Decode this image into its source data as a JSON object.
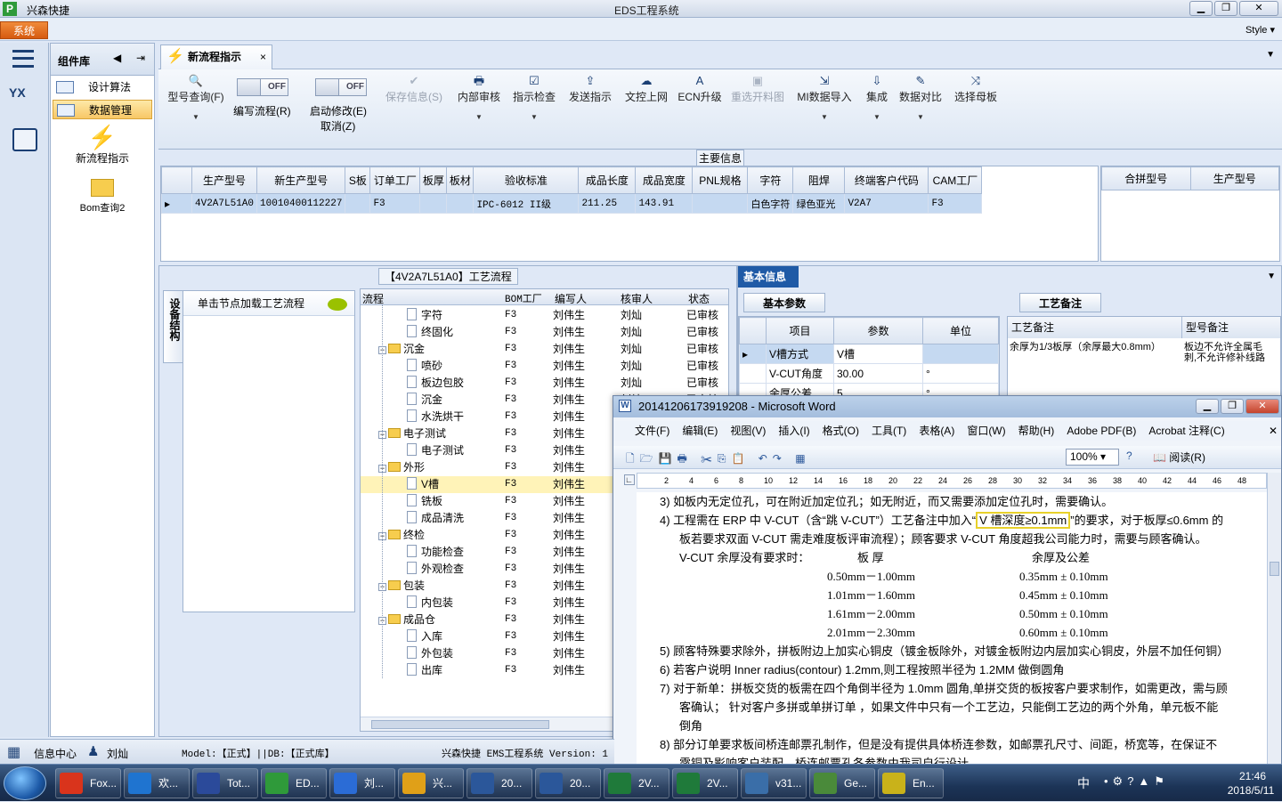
{
  "app": {
    "name": "兴森快捷",
    "title": "EDS工程系统",
    "system_menu": "系统",
    "style_label": "Style"
  },
  "left_rail": {
    "logo_text": "YX"
  },
  "component_library": {
    "title": "组件库",
    "items": [
      "设计算法",
      "数据管理"
    ],
    "shortcuts": [
      "新流程指示",
      "Bom查询2"
    ]
  },
  "tab": {
    "label": "新流程指示",
    "close": "×"
  },
  "ribbon": {
    "query": "型号查询(F)",
    "toggle1": {
      "state": "OFF",
      "label": "编写流程(R)"
    },
    "toggle2": {
      "state": "OFF",
      "label": "启动修改(E)",
      "sub": "取消(Z)"
    },
    "buttons": [
      "保存信息(S)",
      "内部审核",
      "指示检查",
      "发送指示",
      "文控上网",
      "ECN升级",
      "重选开料图",
      "MI数据导入",
      "集成",
      "数据对比",
      "选择母板"
    ]
  },
  "main_info": {
    "title": "主要信息",
    "columns": [
      "生产型号",
      "新生产型号",
      "S板",
      "订单工厂",
      "板厚",
      "板材",
      "验收标准",
      "成品长度",
      "成品宽度",
      "PNL规格",
      "字符",
      "阻焊",
      "终端客户代码",
      "CAM工厂"
    ],
    "row": [
      "4V2A7L51A0",
      "10010400112227",
      "",
      "F3",
      "",
      "",
      "IPC-6012 II级",
      "211.25",
      "143.91",
      "",
      "白色字符",
      "绿色亚光",
      "V2A7",
      "F3"
    ],
    "side_columns": [
      "合拼型号",
      "生产型号"
    ]
  },
  "process": {
    "title": "【4V2A7L51A0】工艺流程",
    "vertical_tab": "设备结构",
    "node_load": "单击节点加载工艺流程",
    "columns": [
      "流程",
      "BOM工厂",
      "编写人",
      "核审人",
      "状态"
    ],
    "rows": [
      {
        "name": "字符",
        "level": 2,
        "type": "doc",
        "factory": "F3",
        "writer": "刘伟生",
        "reviewer": "刘灿",
        "status": "已审核"
      },
      {
        "name": "终固化",
        "level": 2,
        "type": "doc",
        "factory": "F3",
        "writer": "刘伟生",
        "reviewer": "刘灿",
        "status": "已审核"
      },
      {
        "name": "沉金",
        "level": 1,
        "type": "folder",
        "factory": "F3",
        "writer": "刘伟生",
        "reviewer": "刘灿",
        "status": "已审核"
      },
      {
        "name": "喷砂",
        "level": 2,
        "type": "doc",
        "factory": "F3",
        "writer": "刘伟生",
        "reviewer": "刘灿",
        "status": "已审核"
      },
      {
        "name": "板边包胶",
        "level": 2,
        "type": "doc",
        "factory": "F3",
        "writer": "刘伟生",
        "reviewer": "刘灿",
        "status": "已审核"
      },
      {
        "name": "沉金",
        "level": 2,
        "type": "doc",
        "factory": "F3",
        "writer": "刘伟生",
        "reviewer": "刘灿",
        "status": "已审核"
      },
      {
        "name": "水洗烘干",
        "level": 2,
        "type": "doc",
        "factory": "F3",
        "writer": "刘伟生",
        "reviewer": "",
        "status": ""
      },
      {
        "name": "电子测试",
        "level": 1,
        "type": "folder",
        "factory": "F3",
        "writer": "刘伟生",
        "reviewer": "",
        "status": ""
      },
      {
        "name": "电子测试",
        "level": 2,
        "type": "doc",
        "factory": "F3",
        "writer": "刘伟生",
        "reviewer": "",
        "status": ""
      },
      {
        "name": "外形",
        "level": 1,
        "type": "folder",
        "factory": "F3",
        "writer": "刘伟生",
        "reviewer": "",
        "status": ""
      },
      {
        "name": "V槽",
        "level": 2,
        "type": "doc",
        "factory": "F3",
        "writer": "刘伟生",
        "reviewer": "",
        "status": "",
        "selected": true
      },
      {
        "name": "铣板",
        "level": 2,
        "type": "doc",
        "factory": "F3",
        "writer": "刘伟生",
        "reviewer": "",
        "status": ""
      },
      {
        "name": "成品清洗",
        "level": 2,
        "type": "doc",
        "factory": "F3",
        "writer": "刘伟生",
        "reviewer": "",
        "status": ""
      },
      {
        "name": "终检",
        "level": 1,
        "type": "folder",
        "factory": "F3",
        "writer": "刘伟生",
        "reviewer": "",
        "status": ""
      },
      {
        "name": "功能检查",
        "level": 2,
        "type": "doc",
        "factory": "F3",
        "writer": "刘伟生",
        "reviewer": "",
        "status": ""
      },
      {
        "name": "外观检查",
        "level": 2,
        "type": "doc",
        "factory": "F3",
        "writer": "刘伟生",
        "reviewer": "",
        "status": ""
      },
      {
        "name": "包装",
        "level": 1,
        "type": "folder",
        "factory": "F3",
        "writer": "刘伟生",
        "reviewer": "",
        "status": ""
      },
      {
        "name": "内包装",
        "level": 2,
        "type": "doc",
        "factory": "F3",
        "writer": "刘伟生",
        "reviewer": "",
        "status": ""
      },
      {
        "name": "成品仓",
        "level": 1,
        "type": "folder",
        "factory": "F3",
        "writer": "刘伟生",
        "reviewer": "",
        "status": ""
      },
      {
        "name": "入库",
        "level": 2,
        "type": "doc",
        "factory": "F3",
        "writer": "刘伟生",
        "reviewer": "",
        "status": ""
      },
      {
        "name": "外包装",
        "level": 2,
        "type": "doc",
        "factory": "F3",
        "writer": "刘伟生",
        "reviewer": "",
        "status": ""
      },
      {
        "name": "出库",
        "level": 2,
        "type": "doc",
        "factory": "F3",
        "writer": "刘伟生",
        "reviewer": "",
        "status": ""
      }
    ]
  },
  "basic_info": {
    "title": "基本信息",
    "tab_params": "基本参数",
    "tab_notes": "工艺备注",
    "param_columns": [
      "项目",
      "参数",
      "单位"
    ],
    "params": [
      {
        "item": "V槽方式",
        "value": "V槽",
        "unit": ""
      },
      {
        "item": "V-CUT角度",
        "value": "30.00",
        "unit": "°"
      },
      {
        "item": "余厚公差",
        "value": "5",
        "unit": "°"
      }
    ],
    "note_columns": [
      "工艺备注",
      "型号备注"
    ],
    "note_text": "余厚为1/3板厚（余厚最大0.8mm）",
    "model_note": "板边不允许全属毛刺,不允许修补线路"
  },
  "word": {
    "title": "20141206173919208 - Microsoft Word",
    "menus": [
      "文件(F)",
      "编辑(E)",
      "视图(V)",
      "插入(I)",
      "格式(O)",
      "工具(T)",
      "表格(A)",
      "窗口(W)",
      "帮助(H)",
      "Adobe PDF(B)",
      "Acrobat 注释(C)"
    ],
    "zoom": "100%",
    "read_btn": "阅读(R)",
    "ruler": [
      "2",
      "4",
      "6",
      "8",
      "10",
      "12",
      "14",
      "16",
      "18",
      "20",
      "22",
      "24",
      "26",
      "28",
      "30",
      "32",
      "34",
      "36",
      "38",
      "40",
      "42",
      "44",
      "46",
      "48"
    ],
    "lines": {
      "l3": "3)  如板内无定位孔，可在附近加定位孔；如无附近，而又需要添加定位孔时，需要确认。",
      "l4a": "4)  工程需在 ERP 中 V-CUT（含“跳 V-CUT”）工艺备注中加入“",
      "l4hl": "V 槽深度≥0.1mm",
      "l4b": "”的要求，对于板厚≤0.6mm 的",
      "l4c": "板若要求双面 V-CUT 需走难度板评审流程）；顾客要求 V-CUT 角度超我公司能力时，需要与顾客确认。",
      "l4d": "V-CUT 余厚没有要求时：",
      "col_thk": "板  厚",
      "col_res": "余厚及公差",
      "t1a": "0.50mm－1.00mm",
      "t1b": "0.35mm ± 0.10mm",
      "t2a": "1.01mm－1.60mm",
      "t2b": "0.45mm ± 0.10mm",
      "t3a": "1.61mm－2.00mm",
      "t3b": "0.50mm ± 0.10mm",
      "t4a": "2.01mm－2.30mm",
      "t4b": "0.60mm ± 0.10mm",
      "l5": "5)  顾客特殊要求除外，拼板附边上加实心铜皮（镀金板除外，对镀金板附边内层加实心铜皮，外层不加任何铜）",
      "l6": "6)  若客户说明 Inner radius(contour) 1.2mm,则工程按照半径为 1.2MM 做倒圆角",
      "l7a": "7)  对于新单：拼板交货的板需在四个角倒半径为 1.0mm 圆角,单拼交货的板按客户要求制作，如需更改，需与顾",
      "l7b": "客确认；  针对客户多拼或单拼订单 ，如果文件中只有一个工艺边，只能倒工艺边的两个外角，单元板不能",
      "l7c": "倒角",
      "l8a": "8)  部分订单要求板间桥连邮票孔制作，但是没有提供具体桥连参数，如邮票孔尺寸、间距，桥宽等，在保证不",
      "l8b": "露铜及影响客户装配，桥连邮票孔各参数由我司自行设计"
    }
  },
  "status": {
    "info_center": "信息中心",
    "user": "刘灿",
    "model": "Model:【正式】||DB:【正式库】",
    "system": "兴森快捷 EMS工程系统 Version: 1"
  },
  "taskbar": {
    "buttons": [
      "Fox...",
      "欢...",
      "Tot...",
      "ED...",
      "刘...",
      "兴...",
      "20...",
      "20...",
      "2V...",
      "2V...",
      "v31...",
      "Ge...",
      "En..."
    ],
    "lang": "中",
    "time": "21:46",
    "date": "2018/5/11"
  },
  "colors": {
    "accent": "#d65a10",
    "selection": "#c5d9f1",
    "highlight": "#fff3b8"
  }
}
